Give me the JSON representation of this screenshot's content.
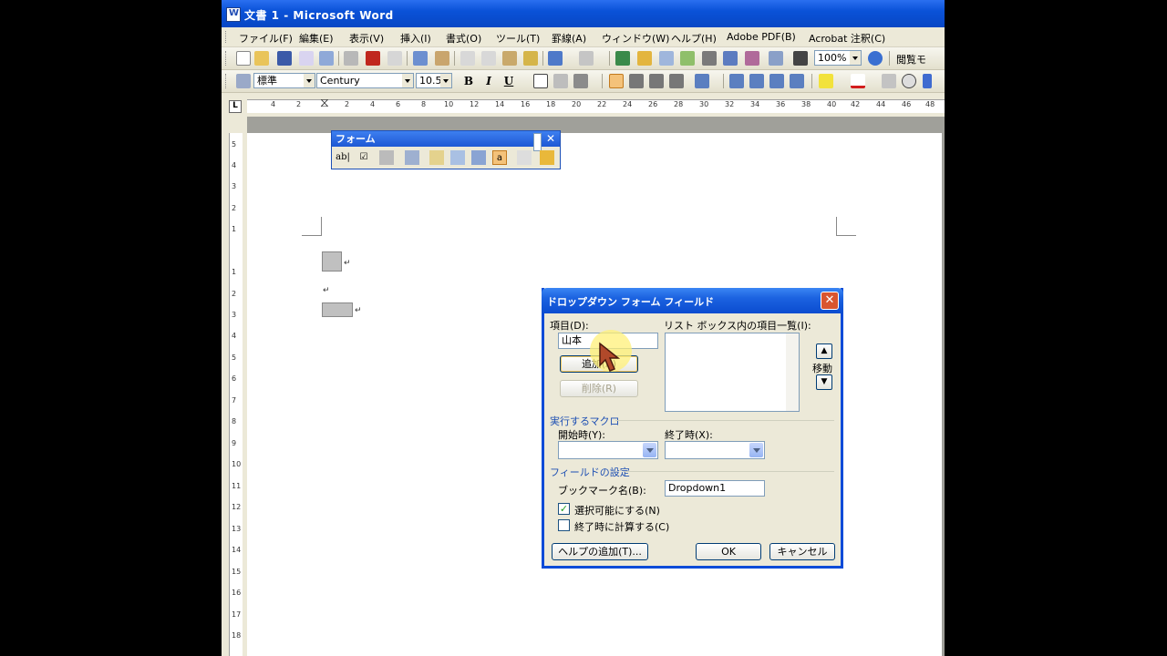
{
  "window": {
    "title": "文書 1 - Microsoft Word"
  },
  "menu": [
    "ファイル(F)",
    "編集(E)",
    "表示(V)",
    "挿入(I)",
    "書式(O)",
    "ツール(T)",
    "罫線(A)",
    "ウィンドウ(W)",
    "ヘルプ(H)",
    "Adobe PDF(B)",
    "Acrobat 注釈(C)"
  ],
  "standard_toolbar": {
    "zoom": "100%",
    "reading_mode": "閲覧モ"
  },
  "format_toolbar": {
    "style": "標準",
    "font": "Century",
    "size": "10.5"
  },
  "ruler": {
    "h_numbers": [
      "4",
      "2",
      "",
      "2",
      "4",
      "6",
      "8",
      "10",
      "12",
      "14",
      "16",
      "18",
      "20",
      "22",
      "24",
      "26",
      "28",
      "30",
      "32",
      "34",
      "36",
      "38",
      "40",
      "42",
      "44",
      "46",
      "48"
    ],
    "v_numbers": [
      "5",
      "4",
      "3",
      "2",
      "1",
      "",
      "1",
      "2",
      "3",
      "4",
      "5",
      "6",
      "7",
      "8",
      "9",
      "10",
      "11",
      "12",
      "13",
      "14",
      "15",
      "16",
      "17",
      "18"
    ]
  },
  "forms_toolbar": {
    "title": "フォーム"
  },
  "dialog": {
    "title": "ドロップダウン フォーム フィールド",
    "item_label": "項目(D):",
    "item_value": "山本",
    "list_label": "リスト ボックス内の項目一覧(I):",
    "add_button": "追加(A)",
    "remove_button": "削除(R)",
    "move_label": "移動",
    "macro_section": "実行するマクロ",
    "on_entry_label": "開始時(Y):",
    "on_exit_label": "終了時(X):",
    "field_section": "フィールドの設定",
    "bookmark_label": "ブックマーク名(B):",
    "bookmark_value": "Dropdown1",
    "enable_label": "選択可能にする(N)",
    "enable_checked": true,
    "calc_label": "終了時に計算する(C)",
    "calc_checked": false,
    "help_button": "ヘルプの追加(T)...",
    "ok_button": "OK",
    "cancel_button": "キャンセル"
  },
  "document": {
    "para_mark": "↵"
  }
}
